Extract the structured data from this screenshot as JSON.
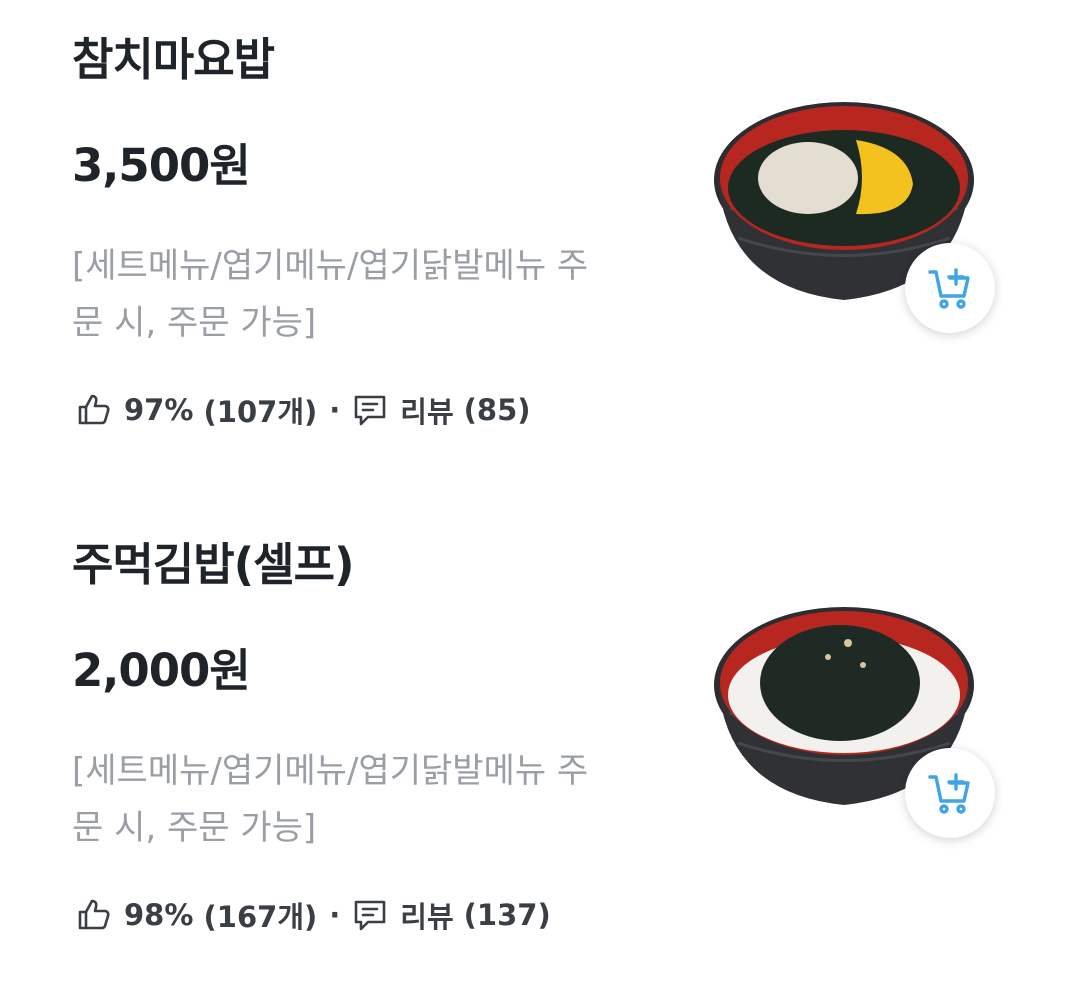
{
  "menu": {
    "items": [
      {
        "name": "참치마요밥",
        "price": "3,500원",
        "description": "[세트메뉴/엽기메뉴/엽기닭발메뉴 주문 시, 주문 가능]",
        "like_percent": "97%",
        "like_count": "(107개)",
        "review_label": "리뷰",
        "review_count": "(85)",
        "photo_icon": "tuna-mayo-rice-bowl",
        "cart_icon": "add-to-cart-icon"
      },
      {
        "name": "주먹김밥(셀프)",
        "price": "2,000원",
        "description": "[세트메뉴/엽기메뉴/엽기닭발메뉴 주문 시, 주문 가능]",
        "like_percent": "98%",
        "like_count": "(167개)",
        "review_label": "리뷰",
        "review_count": "(137)",
        "photo_icon": "seaweed-rice-bowl",
        "cart_icon": "add-to-cart-icon"
      }
    ],
    "separator": "·"
  },
  "colors": {
    "text_primary": "#1f242b",
    "text_secondary": "#9a9ea5",
    "stats_text": "#3a3f46",
    "cart_icon": "#3fa4e8",
    "bowl_inner": "#b8271f",
    "bowl_outer": "#2b2d31"
  }
}
